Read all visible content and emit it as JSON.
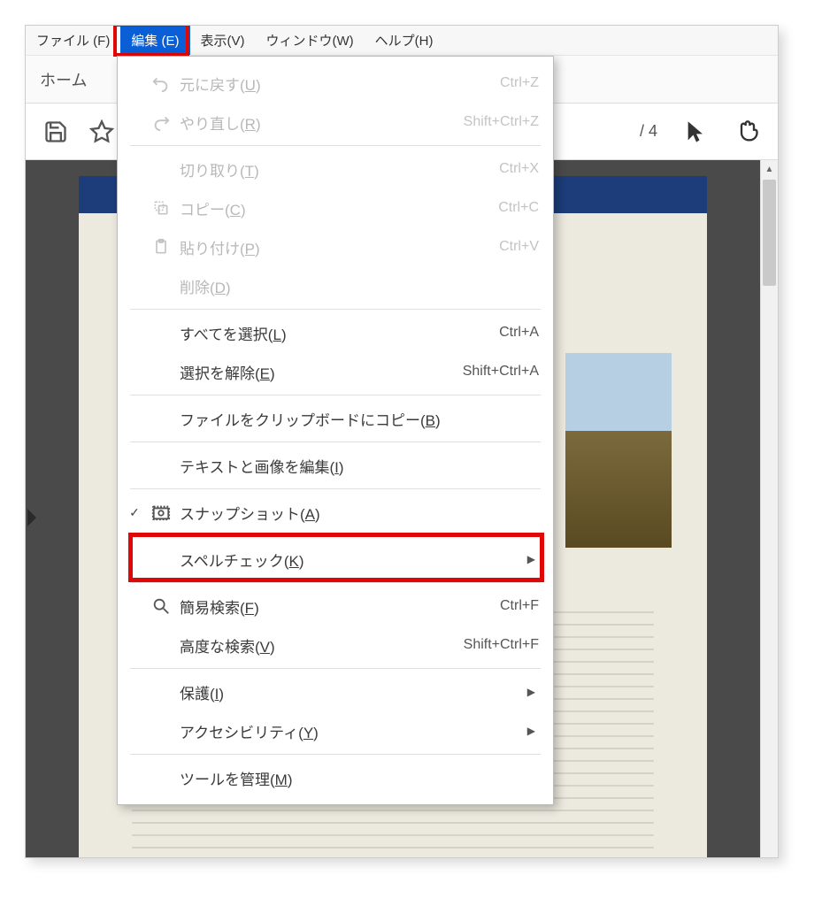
{
  "menubar": {
    "file": "ファイル (F)",
    "edit": "編集 (E)",
    "view": "表示(V)",
    "window": "ウィンドウ(W)",
    "help": "ヘルプ(H)"
  },
  "tabs": {
    "home": "ホーム"
  },
  "toolbar": {
    "page_sep": "/",
    "page_total": "4"
  },
  "dropdown": {
    "undo": {
      "label": "元に戻す",
      "key": "U",
      "shortcut": "Ctrl+Z"
    },
    "redo": {
      "label": "やり直し",
      "key": "R",
      "shortcut": "Shift+Ctrl+Z"
    },
    "cut": {
      "label": "切り取り",
      "key": "T",
      "shortcut": "Ctrl+X"
    },
    "copy": {
      "label": "コピー",
      "key": "C",
      "shortcut": "Ctrl+C"
    },
    "paste": {
      "label": "貼り付け",
      "key": "P",
      "shortcut": "Ctrl+V"
    },
    "delete": {
      "label": "削除",
      "key": "D",
      "shortcut": ""
    },
    "selectall": {
      "label": "すべてを選択",
      "key": "L",
      "shortcut": "Ctrl+A"
    },
    "deselect": {
      "label": "選択を解除",
      "key": "E",
      "shortcut": "Shift+Ctrl+A"
    },
    "copyfile": {
      "label": "ファイルをクリップボードにコピー",
      "key": "B",
      "shortcut": ""
    },
    "edittext": {
      "label": "テキストと画像を編集",
      "key": "I",
      "shortcut": ""
    },
    "snapshot": {
      "label": "スナップショット",
      "key": "A",
      "shortcut": ""
    },
    "spellcheck": {
      "label": "スペルチェック",
      "key": "K",
      "shortcut": ""
    },
    "find": {
      "label": "簡易検索",
      "key": "F",
      "shortcut": "Ctrl+F"
    },
    "advfind": {
      "label": "高度な検索",
      "key": "V",
      "shortcut": "Shift+Ctrl+F"
    },
    "protect": {
      "label": "保護",
      "key": "I",
      "shortcut": ""
    },
    "accessibility": {
      "label": "アクセシビリティ",
      "key": "Y",
      "shortcut": ""
    },
    "managetools": {
      "label": "ツールを管理",
      "key": "M",
      "shortcut": ""
    }
  }
}
